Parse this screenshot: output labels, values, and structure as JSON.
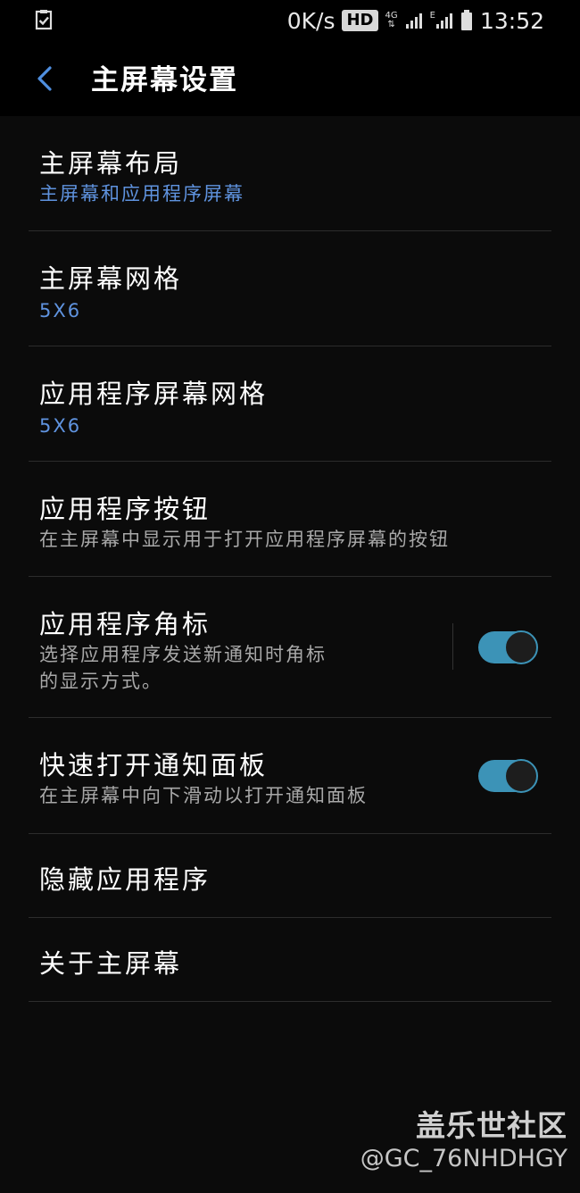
{
  "status_bar": {
    "speed": "0K/s",
    "hd_badge": "HD",
    "network_4g": "4G",
    "network_e": "E",
    "time": "13:52",
    "left_icon": "clipboard-check-icon"
  },
  "app_bar": {
    "back_icon": "chevron-left-icon",
    "title": "主屏幕设置"
  },
  "settings": [
    {
      "label": "主屏幕布局",
      "sub": "主屏幕和应用程序屏幕",
      "sub_style": "value"
    },
    {
      "label": "主屏幕网格",
      "sub": "5X6",
      "sub_style": "value"
    },
    {
      "label": "应用程序屏幕网格",
      "sub": "5X6",
      "sub_style": "value"
    },
    {
      "label": "应用程序按钮",
      "sub": "在主屏幕中显示用于打开应用程序屏幕的按钮",
      "sub_style": "description"
    },
    {
      "label": "应用程序角标",
      "sub_line1": "选择应用程序发送新通知时角标",
      "sub_line2": "的显示方式。",
      "toggle_on": true
    },
    {
      "label": "快速打开通知面板",
      "sub": "在主屏幕中向下滑动以打开通知面板",
      "toggle_on": true
    },
    {
      "label": "隐藏应用程序"
    },
    {
      "label": "关于主屏幕"
    }
  ],
  "colors": {
    "accent_value": "#5f93df",
    "toggle_on": "#3c93b7",
    "back_icon": "#4f8fe0"
  },
  "watermark": {
    "line1": "盖乐世社区",
    "line2": "@GC_76NHDHGY"
  }
}
